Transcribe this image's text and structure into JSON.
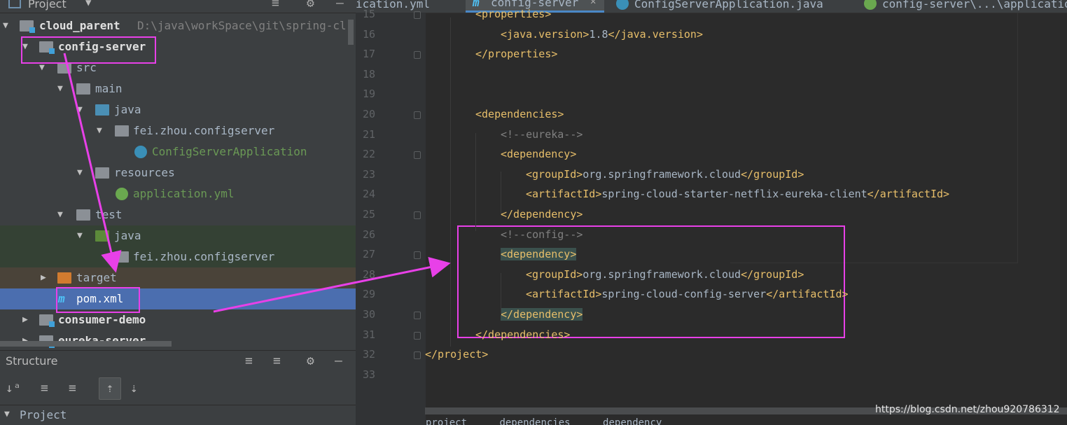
{
  "project_panel": {
    "title": "Project",
    "tree": [
      {
        "label": "cloud_parent",
        "path": "D:\\java\\workSpace\\git\\spring-cl"
      },
      {
        "label": "config-server"
      },
      {
        "label": "src"
      },
      {
        "label": "main"
      },
      {
        "label": "java"
      },
      {
        "label": "fei.zhou.configserver"
      },
      {
        "label": "ConfigServerApplication"
      },
      {
        "label": "resources"
      },
      {
        "label": "application.yml"
      },
      {
        "label": "test"
      },
      {
        "label": "java"
      },
      {
        "label": "fei.zhou.configserver"
      },
      {
        "label": "target"
      },
      {
        "label": "pom.xml"
      },
      {
        "label": "consumer-demo"
      },
      {
        "label": "eureka-server"
      }
    ]
  },
  "structure_panel": {
    "title": "Structure",
    "row": "Project"
  },
  "editor": {
    "tabs": [
      {
        "label": "ication.yml"
      },
      {
        "label": "config-server"
      },
      {
        "label": "ConfigServerApplication.java"
      },
      {
        "label": "config-server\\...\\application"
      }
    ],
    "lines": [
      {
        "n": "15",
        "parts": [
          {
            "c": "tag",
            "t": "<properties>"
          }
        ]
      },
      {
        "n": "16",
        "parts": [
          {
            "c": "tag",
            "t": "<java.version>"
          },
          {
            "c": "txt",
            "t": "1.8"
          },
          {
            "c": "tag",
            "t": "</java.version>"
          }
        ]
      },
      {
        "n": "17",
        "parts": [
          {
            "c": "tag",
            "t": "</properties>"
          }
        ]
      },
      {
        "n": "18",
        "parts": []
      },
      {
        "n": "19",
        "parts": []
      },
      {
        "n": "20",
        "parts": [
          {
            "c": "tag",
            "t": "<dependencies>"
          }
        ]
      },
      {
        "n": "21",
        "parts": [
          {
            "c": "cmt",
            "t": "<!--eureka-->"
          }
        ]
      },
      {
        "n": "22",
        "parts": [
          {
            "c": "tag",
            "t": "<dependency>"
          }
        ]
      },
      {
        "n": "23",
        "parts": [
          {
            "c": "tag",
            "t": "<groupId>"
          },
          {
            "c": "txt",
            "t": "org.springframework.cloud"
          },
          {
            "c": "tag",
            "t": "</groupId>"
          }
        ]
      },
      {
        "n": "24",
        "parts": [
          {
            "c": "tag",
            "t": "<artifactId>"
          },
          {
            "c": "txt",
            "t": "spring-cloud-starter-netflix-eureka-client"
          },
          {
            "c": "tag",
            "t": "</artifactId>"
          }
        ]
      },
      {
        "n": "25",
        "parts": [
          {
            "c": "tag",
            "t": "</dependency>"
          }
        ]
      },
      {
        "n": "26",
        "parts": [
          {
            "c": "cmt",
            "t": "<!--config-->"
          }
        ]
      },
      {
        "n": "27",
        "parts": [
          {
            "c": "tag",
            "t": "<dependency>"
          }
        ]
      },
      {
        "n": "28",
        "parts": [
          {
            "c": "tag",
            "t": "<groupId>"
          },
          {
            "c": "txt",
            "t": "org.springframework.cloud"
          },
          {
            "c": "tag",
            "t": "</groupId>"
          }
        ]
      },
      {
        "n": "29",
        "parts": [
          {
            "c": "tag",
            "t": "<artifactId>"
          },
          {
            "c": "txt",
            "t": "spring-cloud-config-server"
          },
          {
            "c": "tag",
            "t": "</artifactId>"
          }
        ]
      },
      {
        "n": "30",
        "parts": [
          {
            "c": "tag",
            "t": "</dependency>"
          }
        ]
      },
      {
        "n": "31",
        "parts": [
          {
            "c": "tag",
            "t": "</dependencies>"
          }
        ]
      },
      {
        "n": "32",
        "parts": [
          {
            "c": "tag",
            "t": "</project>"
          }
        ]
      },
      {
        "n": "33",
        "parts": []
      }
    ],
    "breadcrumb": [
      "project",
      "dependencies",
      "dependency"
    ]
  },
  "watermark": "https://blog.csdn.net/zhou920786312",
  "colors": {
    "annotation": "#e840e8",
    "selection": "#4b6eaf",
    "tag": "#e8bf6a"
  }
}
